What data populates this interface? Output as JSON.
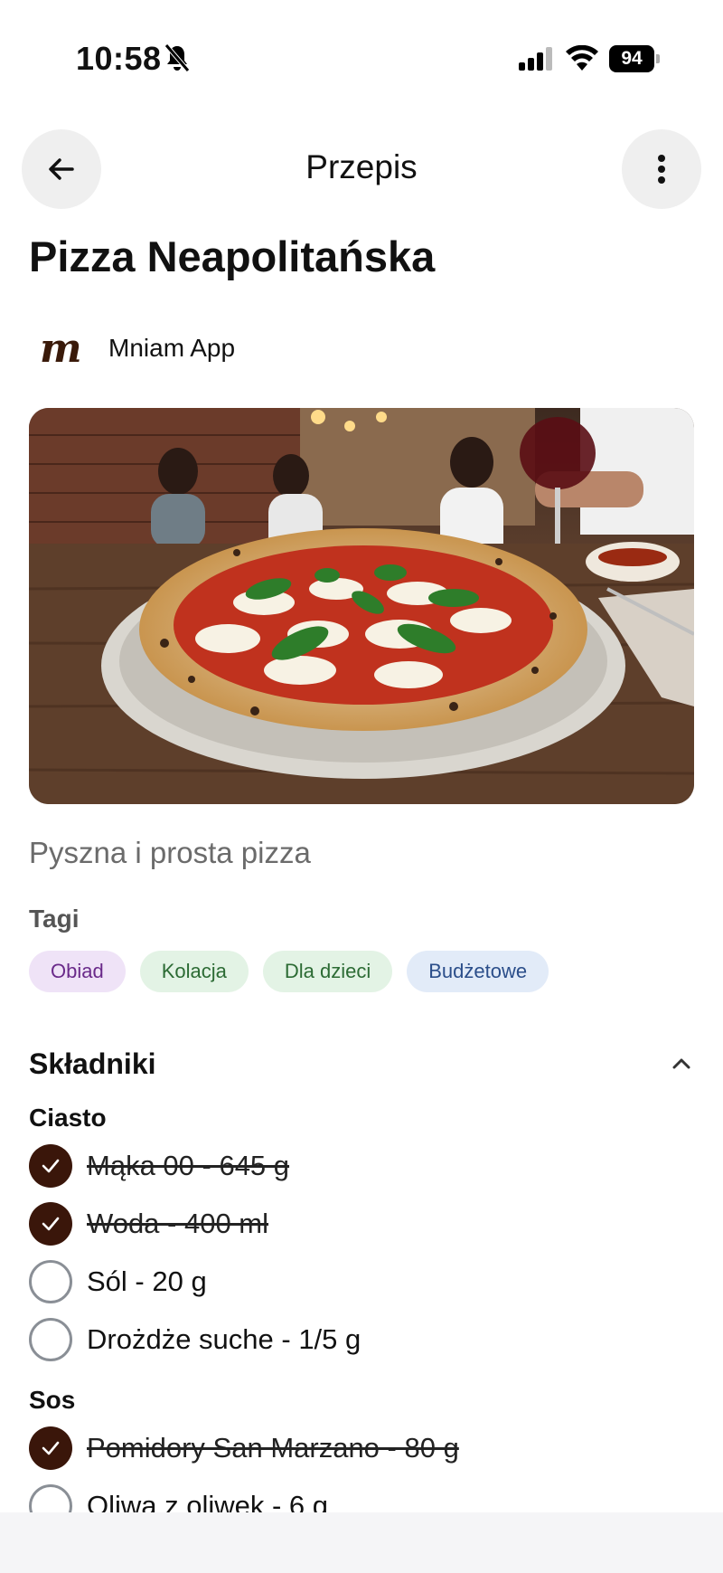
{
  "status_bar": {
    "time": "10:58",
    "battery": "94"
  },
  "header": {
    "title": "Przepis",
    "back_icon": "arrow-left-icon",
    "more_icon": "more-vertical-icon"
  },
  "recipe": {
    "title": "Pizza Neapolitańska",
    "author": {
      "logo_letter": "m",
      "name": "Mniam App"
    },
    "image": "pizza-photo",
    "description": "Pyszna i prosta pizza"
  },
  "tags": {
    "label": "Tagi",
    "items": [
      {
        "label": "Obiad",
        "color": "#efe3f7"
      },
      {
        "label": "Kolacja",
        "color": "#e3f3e5"
      },
      {
        "label": "Dla dzieci",
        "color": "#e3f3e5"
      },
      {
        "label": "Budżetowe",
        "color": "#e2ebf8"
      }
    ]
  },
  "ingredients": {
    "title": "Składniki",
    "groups": [
      {
        "name": "Ciasto",
        "items": [
          {
            "text": "Mąka 00 - 645 g",
            "checked": true
          },
          {
            "text": "Woda - 400 ml",
            "checked": true
          },
          {
            "text": "Sól - 20 g",
            "checked": false
          },
          {
            "text": "Drożdże suche - 1/5 g",
            "checked": false
          }
        ]
      },
      {
        "name": "Sos",
        "items": [
          {
            "text": "Pomidory San Marzano - 80 g",
            "checked": true
          },
          {
            "text": "Oliwa z oliwek - 6 g",
            "checked": false
          }
        ]
      }
    ]
  },
  "colors": {
    "accent": "#3a160a",
    "button_bg": "#efefef"
  }
}
